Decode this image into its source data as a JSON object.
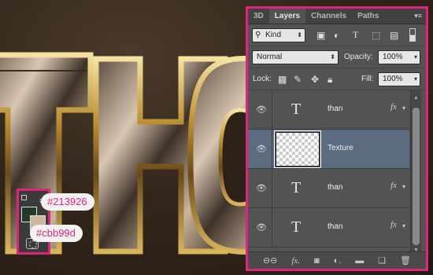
{
  "canvas": {
    "letters": [
      "T",
      "H",
      "O"
    ],
    "foreground_color": "#213926",
    "background_color": "#cbb99d",
    "foreground_label": "#213926",
    "background_label": "#cbb99d",
    "accent": "#e0247b"
  },
  "panel": {
    "tabs": [
      {
        "label": "3D",
        "active": false
      },
      {
        "label": "Layers",
        "active": true
      },
      {
        "label": "Channels",
        "active": false
      },
      {
        "label": "Paths",
        "active": false
      }
    ],
    "filter": {
      "value": "Kind",
      "search_icon": "search-icon"
    },
    "filter_icons": [
      "pixel-layer-icon",
      "adjustment-layer-icon",
      "type-layer-icon",
      "shape-layer-icon",
      "smart-object-icon"
    ],
    "blend_mode": "Normal",
    "opacity_label": "Opacity:",
    "opacity_value": "100%",
    "lock_label": "Lock:",
    "lock_icons": [
      "lock-transparent-icon",
      "lock-image-icon",
      "lock-position-icon",
      "lock-all-icon"
    ],
    "fill_label": "Fill:",
    "fill_value": "100%",
    "layers": [
      {
        "name": "than",
        "type": "text",
        "fx": true,
        "selected": false
      },
      {
        "name": "Texture",
        "type": "pixel",
        "fx": false,
        "selected": true
      },
      {
        "name": "than",
        "type": "text",
        "fx": true,
        "selected": false
      },
      {
        "name": "than",
        "type": "text",
        "fx": true,
        "selected": false
      }
    ],
    "footer_icons": [
      "link-icon",
      "fx-icon",
      "mask-icon",
      "adjustment-icon",
      "folder-icon",
      "new-layer-icon",
      "trash-icon"
    ],
    "type_glyph": "T",
    "fx_glyph": "fx"
  }
}
